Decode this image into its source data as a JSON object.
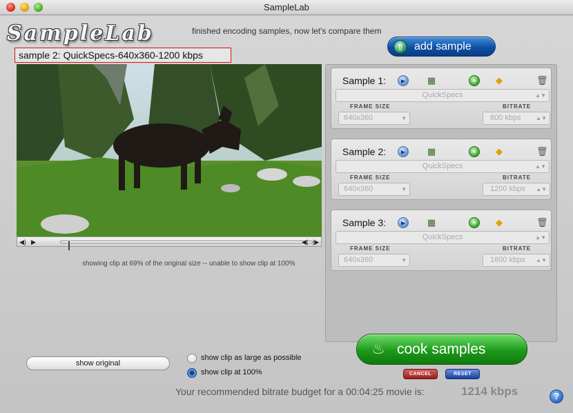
{
  "window": {
    "title": "SampleLab"
  },
  "logo": {
    "text": "SampleLab"
  },
  "status_message": "finished encoding samples, now let's compare them",
  "preview": {
    "title": "sample 2: QuickSpecs-640x360-1200 kbps",
    "clip_note": "showing clip at 69% of the original size -- unable to show clip at 100%",
    "playback_position": 0.03
  },
  "add_sample_label": "add sample",
  "samples": [
    {
      "label": "Sample 1:",
      "preset": "QuickSpecs",
      "frame_size_label": "FRAME SIZE",
      "frame_size": "640x360",
      "bitrate_label": "BITRATE",
      "bitrate": "800 kbps"
    },
    {
      "label": "Sample 2:",
      "preset": "QuickSpecs",
      "frame_size_label": "FRAME SIZE",
      "frame_size": "640x360",
      "bitrate_label": "BITRATE",
      "bitrate": "1200 kbps"
    },
    {
      "label": "Sample 3:",
      "preset": "QuickSpecs",
      "frame_size_label": "FRAME SIZE",
      "frame_size": "640x360",
      "bitrate_label": "BITRATE",
      "bitrate": "1800 kbps"
    }
  ],
  "show_original_label": "show original",
  "display_options": [
    {
      "label": "show clip as large as possible",
      "selected": false
    },
    {
      "label": "show clip at 100%",
      "selected": true
    }
  ],
  "cook_samples_label": "cook samples",
  "cancel_label": "CANCEL",
  "reset_label": "RESET",
  "budget": {
    "text": "Your recommended bitrate budget for a 00:04:25 movie is:",
    "value": "1214 kbps"
  },
  "help_label": "?",
  "colors": {
    "accent_blue": "#0f4fa3",
    "cook_green": "#1e9a1b",
    "highlight_red": "#dd1111"
  }
}
